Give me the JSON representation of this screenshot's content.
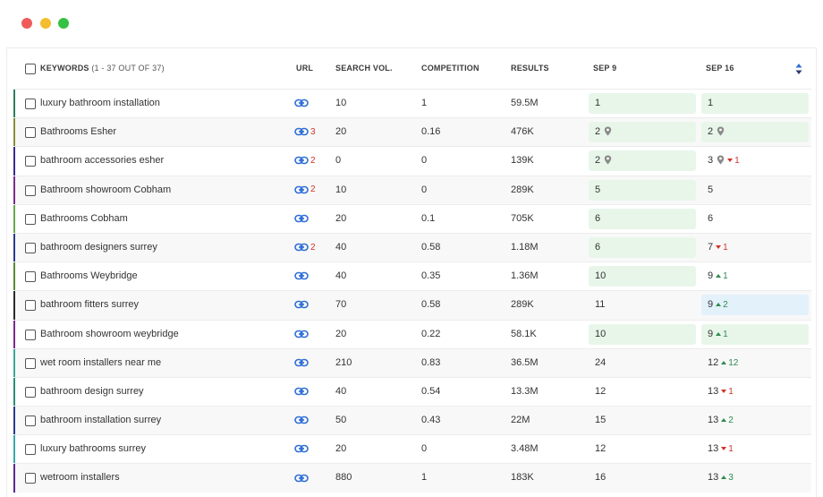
{
  "window": {
    "controls": [
      "close",
      "minimize",
      "maximize"
    ]
  },
  "header": {
    "keywords_label": "KEYWORDS",
    "keywords_count": "(1 - 37 OUT OF 37)",
    "url": "URL",
    "search_vol": "SEARCH VOL.",
    "competition": "COMPETITION",
    "results": "RESULTS",
    "date1": "SEP 9",
    "date2": "SEP 16"
  },
  "colors": {
    "position_green": "#e8f6ea",
    "position_blue": "#e3f1fb",
    "link_icon": "#2f6fd6",
    "decline": "#d0332b",
    "improve": "#2f8a4f"
  },
  "rows": [
    {
      "keyword": "luxury bathroom installation",
      "url_count": "",
      "search_vol": "10",
      "competition": "1",
      "results": "59.5M",
      "sep9": "1",
      "sep9_pin": false,
      "sep9_bg": "green",
      "sep16": "1",
      "sep16_pin": false,
      "sep16_bg": "green",
      "change": "",
      "change_dir": "",
      "bar_color": "#2e7d5b"
    },
    {
      "keyword": "Bathrooms Esher",
      "url_count": "3",
      "search_vol": "20",
      "competition": "0.16",
      "results": "476K",
      "sep9": "2",
      "sep9_pin": true,
      "sep9_bg": "green",
      "sep16": "2",
      "sep16_pin": true,
      "sep16_bg": "green",
      "change": "",
      "change_dir": "",
      "bar_color": "#8a8f3a"
    },
    {
      "keyword": "bathroom accessories esher",
      "url_count": "2",
      "search_vol": "0",
      "competition": "0",
      "results": "139K",
      "sep9": "2",
      "sep9_pin": true,
      "sep9_bg": "green",
      "sep16": "3",
      "sep16_pin": true,
      "sep16_bg": "none",
      "change": "1",
      "change_dir": "down",
      "bar_color": "#3b2a8c"
    },
    {
      "keyword": "Bathroom showroom Cobham",
      "url_count": "2",
      "search_vol": "10",
      "competition": "0",
      "results": "289K",
      "sep9": "5",
      "sep9_pin": false,
      "sep9_bg": "green",
      "sep16": "5",
      "sep16_pin": false,
      "sep16_bg": "none",
      "change": "",
      "change_dir": "",
      "bar_color": "#7a2a8c"
    },
    {
      "keyword": "Bathrooms Cobham",
      "url_count": "",
      "search_vol": "20",
      "competition": "0.1",
      "results": "705K",
      "sep9": "6",
      "sep9_pin": false,
      "sep9_bg": "green",
      "sep16": "6",
      "sep16_pin": false,
      "sep16_bg": "none",
      "change": "",
      "change_dir": "",
      "bar_color": "#6aa84f"
    },
    {
      "keyword": "bathroom designers surrey",
      "url_count": "2",
      "search_vol": "40",
      "competition": "0.58",
      "results": "1.18M",
      "sep9": "6",
      "sep9_pin": false,
      "sep9_bg": "green",
      "sep16": "7",
      "sep16_pin": false,
      "sep16_bg": "none",
      "change": "1",
      "change_dir": "down",
      "bar_color": "#2a3a8c"
    },
    {
      "keyword": "Bathrooms Weybridge",
      "url_count": "",
      "search_vol": "40",
      "competition": "0.35",
      "results": "1.36M",
      "sep9": "10",
      "sep9_pin": false,
      "sep9_bg": "green",
      "sep16": "9",
      "sep16_pin": false,
      "sep16_bg": "none",
      "change": "1",
      "change_dir": "up",
      "bar_color": "#5a8a3a"
    },
    {
      "keyword": "bathroom fitters surrey",
      "url_count": "",
      "search_vol": "70",
      "competition": "0.58",
      "results": "289K",
      "sep9": "11",
      "sep9_pin": false,
      "sep9_bg": "none",
      "sep16": "9",
      "sep16_pin": false,
      "sep16_bg": "blue",
      "change": "2",
      "change_dir": "up",
      "bar_color": "#2a2a2a"
    },
    {
      "keyword": "Bathroom showroom weybridge",
      "url_count": "",
      "search_vol": "20",
      "competition": "0.22",
      "results": "58.1K",
      "sep9": "10",
      "sep9_pin": false,
      "sep9_bg": "green",
      "sep16": "9",
      "sep16_pin": false,
      "sep16_bg": "green",
      "change": "1",
      "change_dir": "up",
      "bar_color": "#7a2a8c"
    },
    {
      "keyword": "wet room installers near me",
      "url_count": "",
      "search_vol": "210",
      "competition": "0.83",
      "results": "36.5M",
      "sep9": "24",
      "sep9_pin": false,
      "sep9_bg": "none",
      "sep16": "12",
      "sep16_pin": false,
      "sep16_bg": "none",
      "change": "12",
      "change_dir": "up",
      "bar_color": "#3aa89a"
    },
    {
      "keyword": "bathroom design surrey",
      "url_count": "",
      "search_vol": "40",
      "competition": "0.54",
      "results": "13.3M",
      "sep9": "12",
      "sep9_pin": false,
      "sep9_bg": "none",
      "sep16": "13",
      "sep16_pin": false,
      "sep16_bg": "none",
      "change": "1",
      "change_dir": "down",
      "bar_color": "#2a8c7a"
    },
    {
      "keyword": "bathroom installation surrey",
      "url_count": "",
      "search_vol": "50",
      "competition": "0.43",
      "results": "22M",
      "sep9": "15",
      "sep9_pin": false,
      "sep9_bg": "none",
      "sep16": "13",
      "sep16_pin": false,
      "sep16_bg": "none",
      "change": "2",
      "change_dir": "up",
      "bar_color": "#2a3a8c"
    },
    {
      "keyword": "luxury bathrooms surrey",
      "url_count": "",
      "search_vol": "20",
      "competition": "0",
      "results": "3.48M",
      "sep9": "12",
      "sep9_pin": false,
      "sep9_bg": "none",
      "sep16": "13",
      "sep16_pin": false,
      "sep16_bg": "none",
      "change": "1",
      "change_dir": "down",
      "bar_color": "#3aa8a8"
    },
    {
      "keyword": "wetroom installers",
      "url_count": "",
      "search_vol": "880",
      "competition": "1",
      "results": "183K",
      "sep9": "16",
      "sep9_pin": false,
      "sep9_bg": "none",
      "sep16": "13",
      "sep16_pin": false,
      "sep16_bg": "none",
      "change": "3",
      "change_dir": "up",
      "bar_color": "#5a2a8c"
    }
  ]
}
